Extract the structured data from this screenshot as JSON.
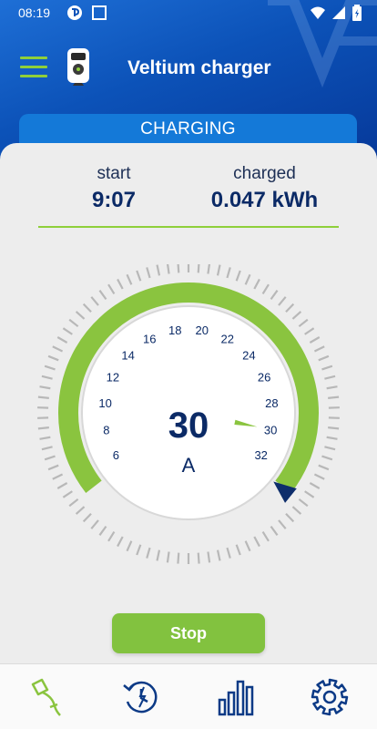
{
  "status_bar": {
    "time": "08:19"
  },
  "header": {
    "title": "Veltium charger",
    "status": "CHARGING"
  },
  "stats": {
    "start_label": "start",
    "start_value": "9:07",
    "charged_label": "charged",
    "charged_value": "0.047 kWh"
  },
  "gauge": {
    "value": "30",
    "unit": "A",
    "scale_labels": [
      "6",
      "8",
      "10",
      "12",
      "14",
      "16",
      "18",
      "20",
      "22",
      "24",
      "26",
      "28",
      "30",
      "32"
    ],
    "current_amps": 30,
    "max_setting_amps": 32
  },
  "actions": {
    "stop_label": "Stop"
  },
  "nav": [
    "charge-icon",
    "history-icon",
    "stats-icon",
    "settings-icon"
  ],
  "colors": {
    "primary": "#0c52b8",
    "accent": "#82c23f",
    "text_dark": "#0b2a66"
  }
}
